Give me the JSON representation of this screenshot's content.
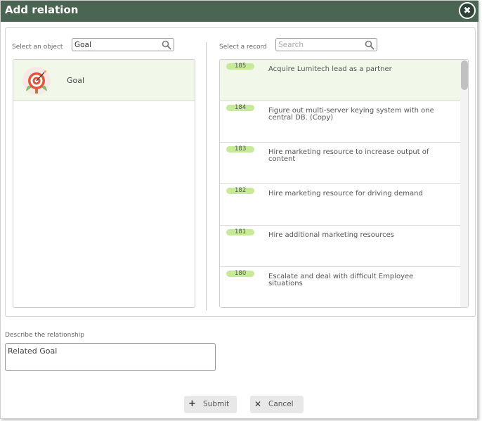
{
  "dialog": {
    "title": "Add relation",
    "close_glyph": "✖"
  },
  "object_panel": {
    "label": "Select an object",
    "search_value": "Goal",
    "items": [
      {
        "name": "Goal",
        "icon": "target-goal-icon"
      }
    ]
  },
  "record_panel": {
    "label": "Select a record",
    "search_placeholder": "Search",
    "records": [
      {
        "id": "185",
        "title": "Acquire Lumitech lead as a partner",
        "selected": true
      },
      {
        "id": "184",
        "title": "Figure out multi-server keying system with one central DB. (Copy)",
        "selected": false
      },
      {
        "id": "183",
        "title": "Hire marketing resource to increase output of content",
        "selected": false
      },
      {
        "id": "182",
        "title": "Hire marketing resource for driving demand",
        "selected": false
      },
      {
        "id": "181",
        "title": "Hire additional marketing resources",
        "selected": false
      },
      {
        "id": "180",
        "title": "Escalate and deal with difficult Employee situations",
        "selected": false
      }
    ]
  },
  "relationship": {
    "label": "Describe the relationship",
    "value": "Related Goal"
  },
  "buttons": {
    "submit_label": "Submit",
    "submit_icon": "plus-icon",
    "cancel_label": "Cancel",
    "cancel_icon": "x-icon"
  },
  "colors": {
    "titlebar": "#4a6652",
    "selected_row": "#f1f8ea",
    "id_badge": "#c7ea98",
    "button_bg": "#e8e8e8"
  }
}
